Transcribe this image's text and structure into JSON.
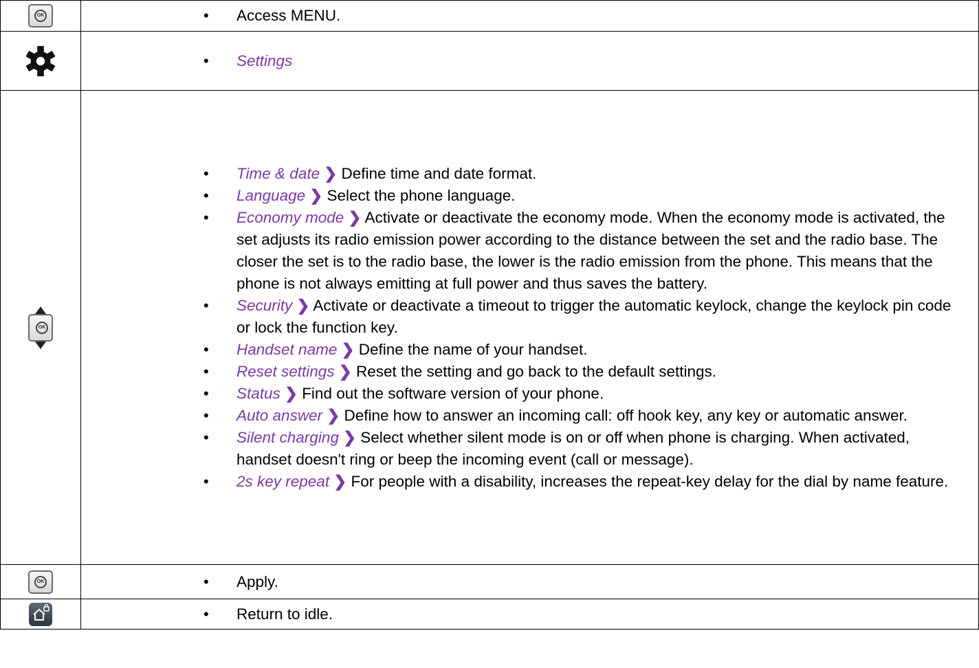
{
  "steps": [
    {
      "icon": "ok-key-icon",
      "items": [
        {
          "term": "",
          "text": "Access MENU."
        }
      ]
    },
    {
      "icon": "gear-icon",
      "items": [
        {
          "term": "Settings",
          "text": ""
        }
      ]
    },
    {
      "icon": "navigation-key-icon",
      "items": [
        {
          "term": "Time & date",
          "text": "Define time and date format."
        },
        {
          "term": "Language",
          "text": "Select the phone language."
        },
        {
          "term": "Economy mode",
          "text": "Activate or deactivate the economy mode. When the economy mode is activated, the set adjusts its radio emission power according to the distance between the set and the radio base. The closer the set is to the radio base, the lower is the radio emission from the phone. This means that the phone is not always emitting at full power and thus saves the battery."
        },
        {
          "term": "Security",
          "text": "Activate or deactivate a timeout to trigger the automatic keylock, change the keylock pin code or lock the function key."
        },
        {
          "term": "Handset name",
          "text": "Define the name of your handset."
        },
        {
          "term": "Reset settings",
          "text": "Reset the setting and go back to the default settings."
        },
        {
          "term": "Status",
          "text": "Find out the software version of your phone."
        },
        {
          "term": "Auto answer",
          "text": "Define how to answer an incoming call: off hook key, any key or automatic answer."
        },
        {
          "term": "Silent charging",
          "text": "Select whether silent mode is on or off when phone is charging. When activated, handset doesn't ring or beep the incoming event (call or message)."
        },
        {
          "term": "2s key repeat",
          "text": "For people with a disability, increases the repeat-key delay for the dial by name feature."
        }
      ]
    },
    {
      "icon": "ok-key-icon",
      "items": [
        {
          "term": "",
          "text": "Apply."
        }
      ]
    },
    {
      "icon": "home-key-icon",
      "items": [
        {
          "term": "",
          "text": "Return to idle."
        }
      ]
    }
  ],
  "ok_glyph": "OK",
  "separator": "❯",
  "colors": {
    "term": "#7a3aa8",
    "border": "#000000"
  }
}
